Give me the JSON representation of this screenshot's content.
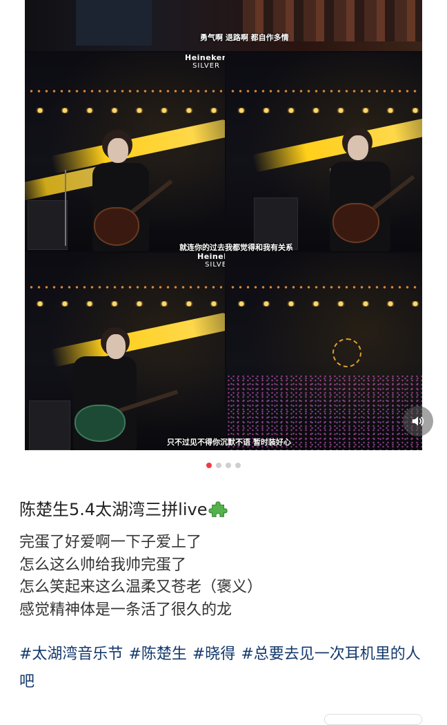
{
  "media": {
    "brand_name": "Heineken",
    "brand_sub": "SILVER",
    "top_caption": "勇气啊  退路啊  都自作多情",
    "caption_middle": "就连你的过去我都觉得和我有关系",
    "caption_bottom": "只不过见不得你沉默不语  暂时装好心",
    "page_count": 4,
    "current_page": 1
  },
  "icons": {
    "sound": "speaker-icon",
    "title_emoji": "puzzle-piece-icon"
  },
  "colors": {
    "active_dot": "#ef3b47",
    "inactive_dot": "#cfcfcf",
    "hashtag": "#13386c"
  },
  "post": {
    "title": "陈楚生5.4太湖湾三拼live",
    "lines": [
      "完蛋了好爱啊一下子爱上了",
      "怎么这么帅给我帅完蛋了",
      "怎么笑起来这么温柔又苍老（褒义）",
      "感觉精神体是一条活了很久的龙"
    ],
    "hashtags": [
      "#太湖湾音乐节",
      "#陈楚生",
      "#晓得",
      "#总要去见一次耳机里的人吧"
    ]
  }
}
